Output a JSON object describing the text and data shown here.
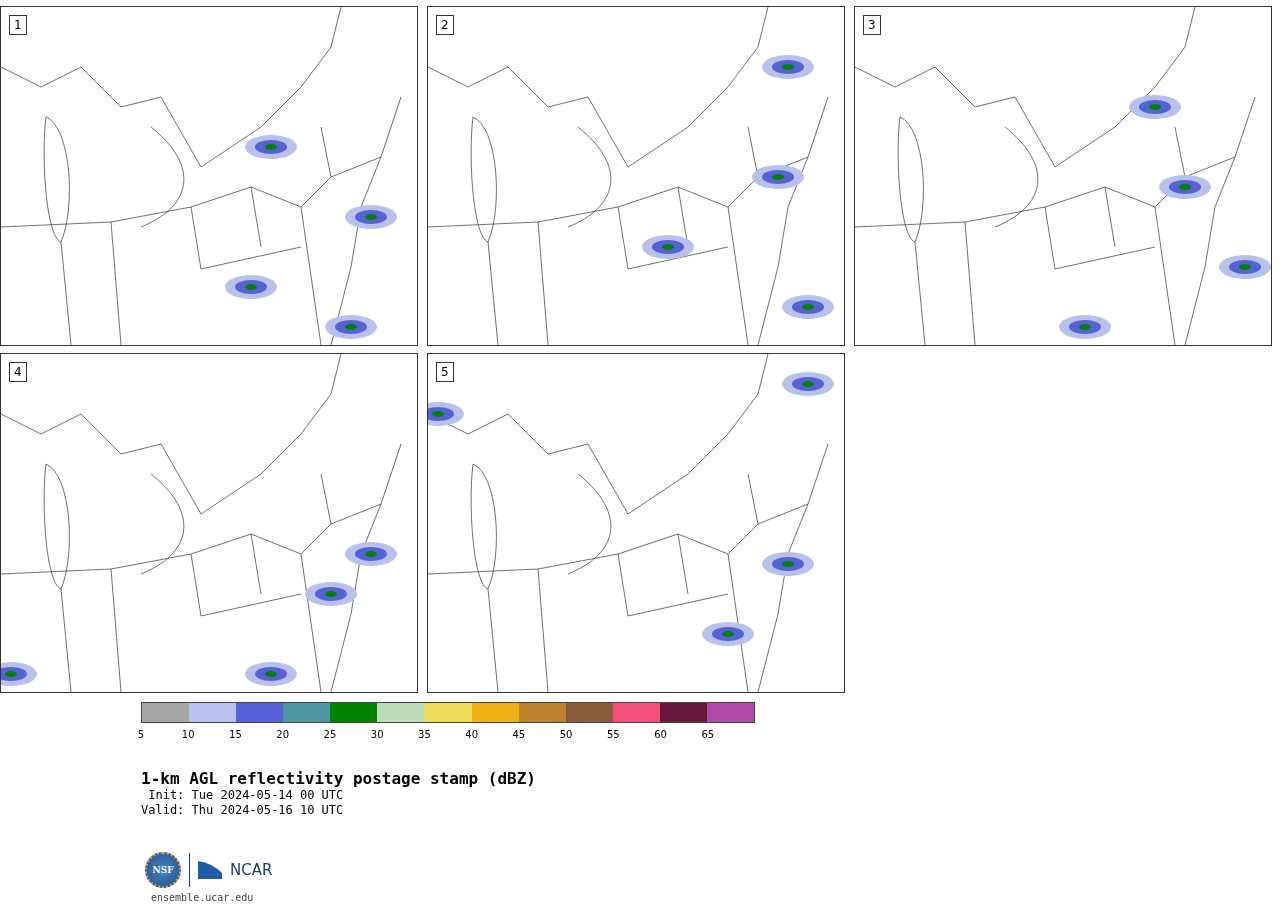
{
  "panels": [
    {
      "label": "1"
    },
    {
      "label": "2"
    },
    {
      "label": "3"
    },
    {
      "label": "4"
    },
    {
      "label": "5"
    }
  ],
  "colorbar": {
    "bins": [
      {
        "tick": "5",
        "color": "#a6a6a6"
      },
      {
        "tick": "10",
        "color": "#b7c1ec"
      },
      {
        "tick": "15",
        "color": "#5561d6"
      },
      {
        "tick": "20",
        "color": "#4f97a0"
      },
      {
        "tick": "25",
        "color": "#008400"
      },
      {
        "tick": "30",
        "color": "#bcddb9"
      },
      {
        "tick": "35",
        "color": "#eddc5a"
      },
      {
        "tick": "40",
        "color": "#eeaf17"
      },
      {
        "tick": "45",
        "color": "#bb832d"
      },
      {
        "tick": "50",
        "color": "#8a5a3d"
      },
      {
        "tick": "55",
        "color": "#f3517c"
      },
      {
        "tick": "60",
        "color": "#66183a"
      },
      {
        "tick": "65",
        "color": "#af4ba6"
      }
    ]
  },
  "title": "1-km AGL reflectivity postage stamp (dBZ)",
  "init": " Init: Tue 2024-05-14 00 UTC",
  "valid": "Valid: Thu 2024-05-16 10 UTC",
  "logos": {
    "nsf": "NSF",
    "ncar": "NCAR"
  },
  "url": "ensemble.ucar.edu"
}
